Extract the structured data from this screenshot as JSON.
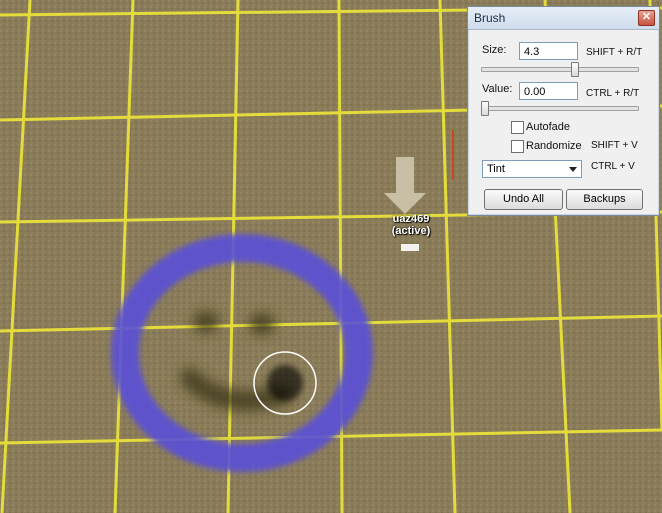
{
  "scene": {
    "object_name": "uaz469",
    "object_status": "(active)"
  },
  "brush_panel": {
    "title": "Brush",
    "close_icon": "close-icon",
    "size": {
      "label": "Size:",
      "value": "4.3",
      "shortcut": "SHIFT + R/T",
      "slider_fraction": 0.6
    },
    "value": {
      "label": "Value:",
      "value": "0.00",
      "shortcut": "CTRL + R/T",
      "slider_fraction": 0.0
    },
    "autofade": {
      "label": "Autofade",
      "checked": false
    },
    "randomize": {
      "label": "Randomize",
      "checked": false,
      "shortcut": "SHIFT + V"
    },
    "mode": {
      "selected": "Tint",
      "shortcut": "CTRL + V"
    },
    "buttons": {
      "undo_all": "Undo All",
      "backups": "Backups"
    }
  },
  "colors": {
    "ground": "#8a7c58",
    "grid": "#e8e23a",
    "ring": "#5a4fd8",
    "titlebar": "#dbe6f4"
  }
}
